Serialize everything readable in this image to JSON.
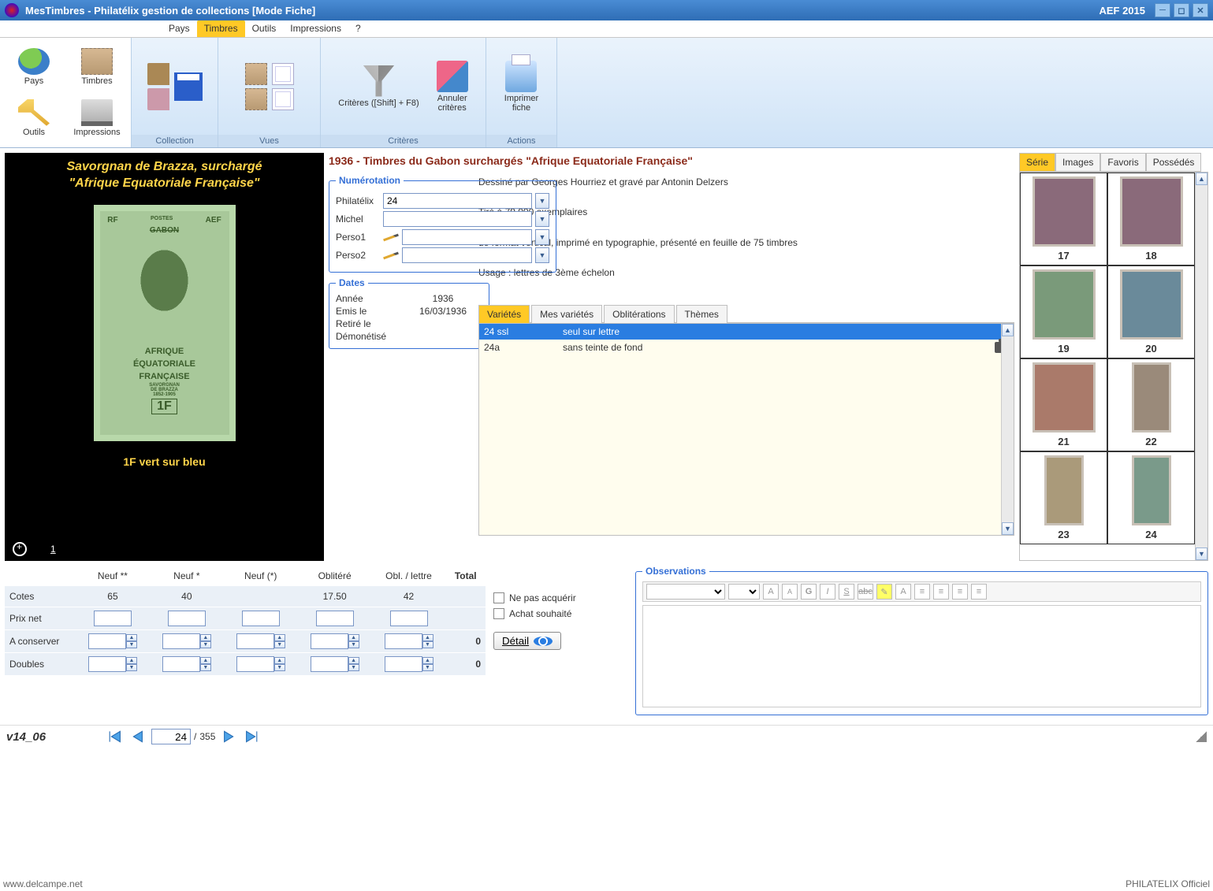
{
  "window": {
    "title": "MesTimbres - Philatélix gestion de collections [Mode Fiche]",
    "right_label": "AEF 2015"
  },
  "menubar": [
    "Pays",
    "Timbres",
    "Outils",
    "Impressions",
    "?"
  ],
  "menubar_active": 1,
  "ribbon_left": [
    {
      "label": "Pays",
      "icon": "globe"
    },
    {
      "label": "Timbres",
      "icon": "stampicn"
    },
    {
      "label": "Outils",
      "icon": "wrench"
    },
    {
      "label": "Impressions",
      "icon": "scanner"
    }
  ],
  "ribbon_groups": {
    "collection": "Collection",
    "vues": "Vues",
    "criteres": "Critères",
    "actions": "Actions",
    "criteres_btn": "Critères ([Shift] + F8)",
    "annuler_btn": "Annuler\ncritères",
    "imprimer_btn": "Imprimer\nfiche"
  },
  "headline": "1936 - Timbres du Gabon surchargés \"Afrique Equatoriale Française\"",
  "preview": {
    "title1": "Savorgnan de Brazza, surchargé",
    "title2": "\"Afrique Equatoriale Française\"",
    "caption": "1F vert sur bleu",
    "page": "1",
    "stamp_top_left": "RF",
    "stamp_top_mid": "POSTES",
    "stamp_top_right": "AEF",
    "stamp_strike": "GABON",
    "stamp_ovp1": "AFRIQUE",
    "stamp_ovp2": "ÉQUATORIALE",
    "stamp_ovp3": "FRANÇAISE",
    "stamp_name": "SAVORGNAN\nDE BRAZZA\n1852-1905",
    "stamp_face": "1F"
  },
  "numerotation": {
    "legend": "Numérotation",
    "philatelix_label": "Philatélix",
    "philatelix_value": "24",
    "michel_label": "Michel",
    "michel_value": "",
    "perso1_label": "Perso1",
    "perso1_value": "",
    "perso2_label": "Perso2",
    "perso2_value": ""
  },
  "description": {
    "line1": "Dessiné par Georges Hourriez et gravé par Antonin Delzers",
    "line2": "Tiré à 79 000 exemplaires",
    "line3": "de format vertical, imprimé en typographie, présenté en feuille de 75 timbres",
    "line4": "Usage : lettres de 3ème échelon"
  },
  "dates": {
    "legend": "Dates",
    "annee_l": "Année",
    "annee_v": "1936",
    "emis_l": "Emis le",
    "emis_v": "16/03/1936",
    "retire_l": "Retiré le",
    "retire_v": "",
    "demon_l": "Démonétisé",
    "demon_v": ""
  },
  "mid_tabs": [
    "Variétés",
    "Mes variétés",
    "Oblitérations",
    "Thèmes"
  ],
  "mid_tabs_active": 0,
  "varietes": [
    {
      "code": "24 ssl",
      "desc": "seul sur lettre",
      "selected": true,
      "camera": false
    },
    {
      "code": "24a",
      "desc": "sans teinte de fond",
      "selected": false,
      "camera": true
    }
  ],
  "right_tabs": [
    "Série",
    "Images",
    "Favoris",
    "Possédés"
  ],
  "right_tabs_active": 0,
  "thumbs": [
    "17",
    "18",
    "19",
    "20",
    "21",
    "22",
    "23",
    "24"
  ],
  "price_table": {
    "headers": [
      "",
      "Neuf **",
      "Neuf *",
      "Neuf (*)",
      "Oblitéré",
      "Obl. / lettre",
      "Total"
    ],
    "rows": [
      {
        "label": "Cotes",
        "vals": [
          "65",
          "40",
          "",
          "17.50",
          "42",
          ""
        ]
      },
      {
        "label": "Prix net",
        "vals": [
          "",
          "",
          "",
          "",
          "",
          ""
        ],
        "inputs": true
      },
      {
        "label": "A conserver",
        "vals": [
          "",
          "",
          "",
          "",
          "",
          "0"
        ],
        "spin": true
      },
      {
        "label": "Doubles",
        "vals": [
          "",
          "",
          "",
          "",
          "",
          "0"
        ],
        "spin": true
      }
    ]
  },
  "checks": {
    "nepas": "Ne pas acquérir",
    "achat": "Achat souhaité",
    "detail": "Détail"
  },
  "observations": {
    "legend": "Observations"
  },
  "nav": {
    "version": "v14_06",
    "current": "24",
    "sep": "/",
    "total": "355"
  },
  "watermarks": {
    "bl": "www.delcampe.net",
    "br": "PHILATELIX Officiel"
  }
}
